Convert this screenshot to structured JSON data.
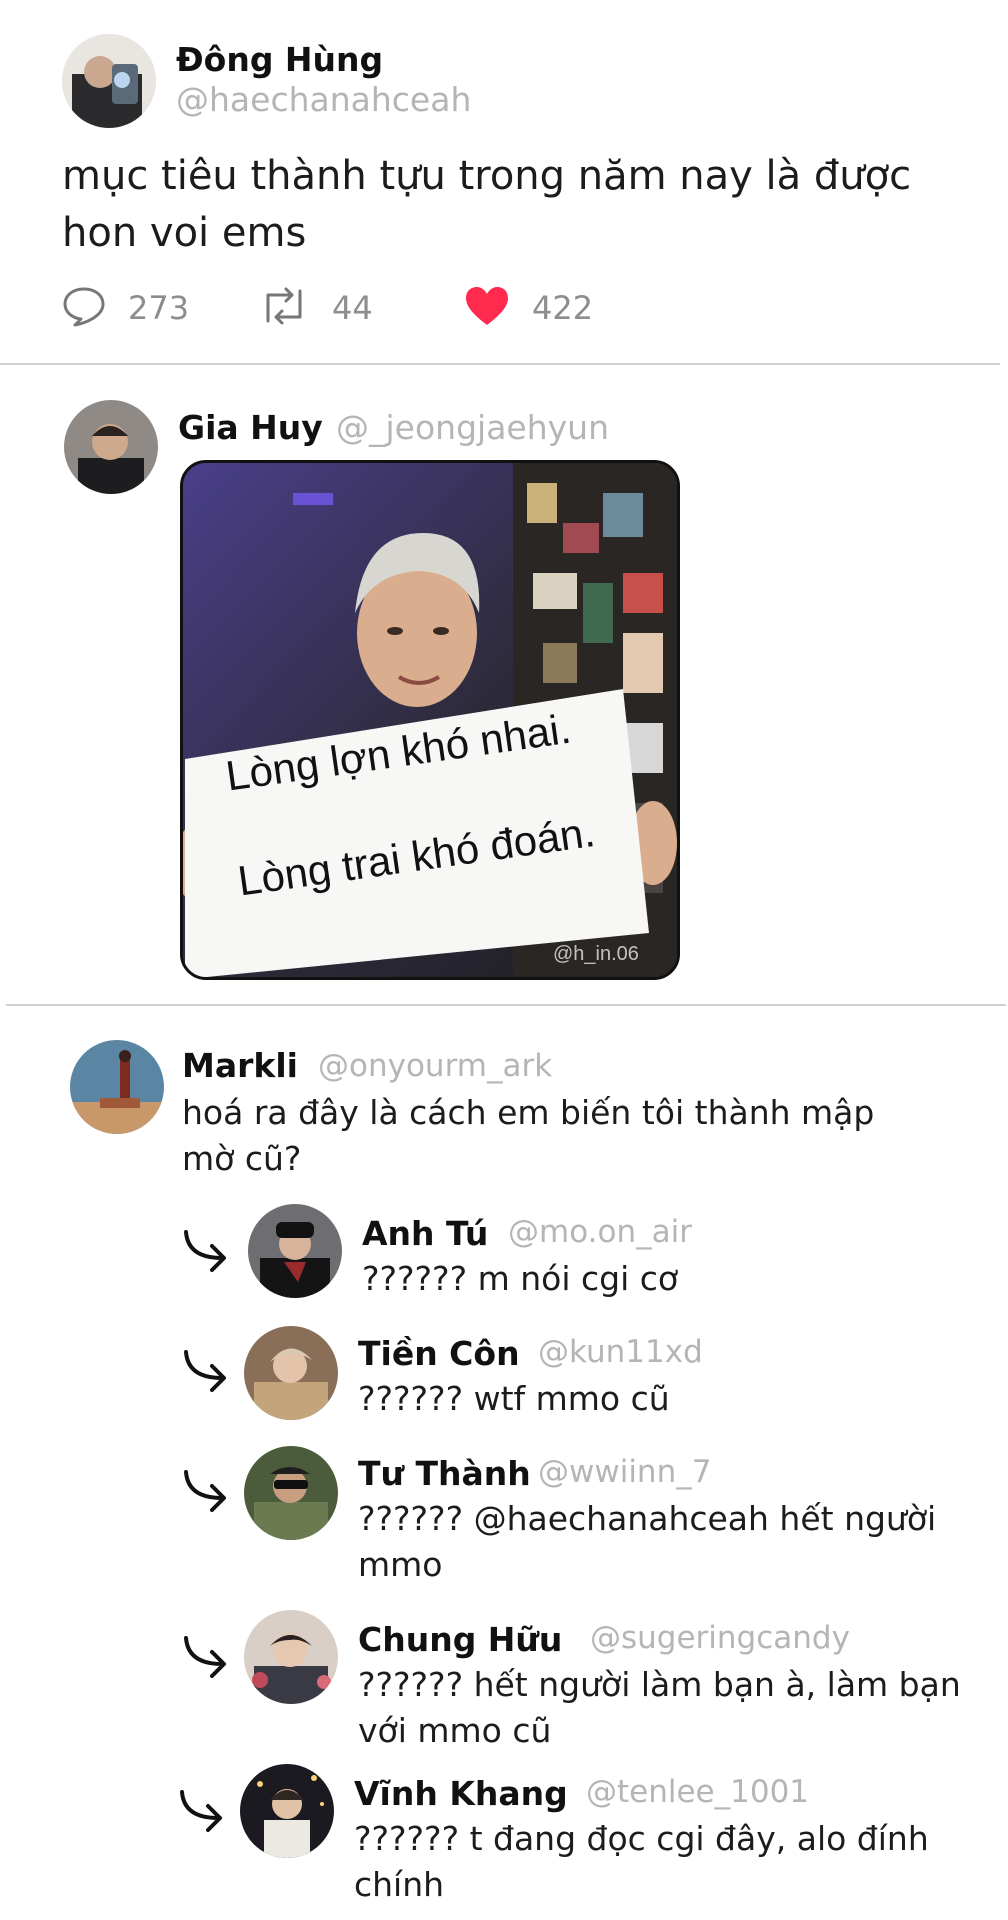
{
  "post": {
    "author": {
      "name": "Đông Hùng",
      "handle": "@haechanahceah"
    },
    "text_lines": [
      "mục tiêu thành tựu trong năm nay là được",
      "hon voi ems"
    ],
    "actions": {
      "replies": "273",
      "retweets": "44",
      "likes": "422"
    }
  },
  "reply": {
    "author": {
      "name": "Gia Huy",
      "handle": "@_jeongjaehyun"
    },
    "image": {
      "sign_line1": "Lòng lợn khó nhai.",
      "sign_line2": "Lòng trai khó đoán.",
      "watermark": "@h_in.06"
    }
  },
  "thread": {
    "author": {
      "name": "Markli",
      "handle": "@onyourm_ark"
    },
    "text_lines": [
      "hoá ra đây là cách em biến tôi thành mập",
      "mờ cũ?"
    ],
    "replies": [
      {
        "name": "Anh Tú",
        "handle": "@mo.on_air",
        "text_lines": [
          "?????? m nói cgi cơ"
        ]
      },
      {
        "name": "Tiền Côn",
        "handle": "@kun11xd",
        "text_lines": [
          "?????? wtf mmo cũ"
        ]
      },
      {
        "name": "Tư Thành",
        "handle": "@wwiinn_7",
        "text_lines": [
          "?????? @haechanahceah hết người",
          "mmo"
        ]
      },
      {
        "name": "Chung Hữu",
        "handle": "@sugeringcandy",
        "text_lines": [
          "?????? hết người làm bạn à, làm bạn",
          "với mmo cũ"
        ]
      },
      {
        "name": "Vĩnh Khang",
        "handle": "@tenlee_1001",
        "text_lines": [
          "?????? t đang đọc cgi đây, alo đính",
          "chính"
        ]
      }
    ]
  },
  "colors": {
    "like": "#ff2a4e",
    "muted": "#b5b5b5",
    "divider": "#cfcfcf"
  },
  "icons": [
    "reply-icon",
    "retweet-icon",
    "heart-icon",
    "reply-arrow-icon"
  ]
}
